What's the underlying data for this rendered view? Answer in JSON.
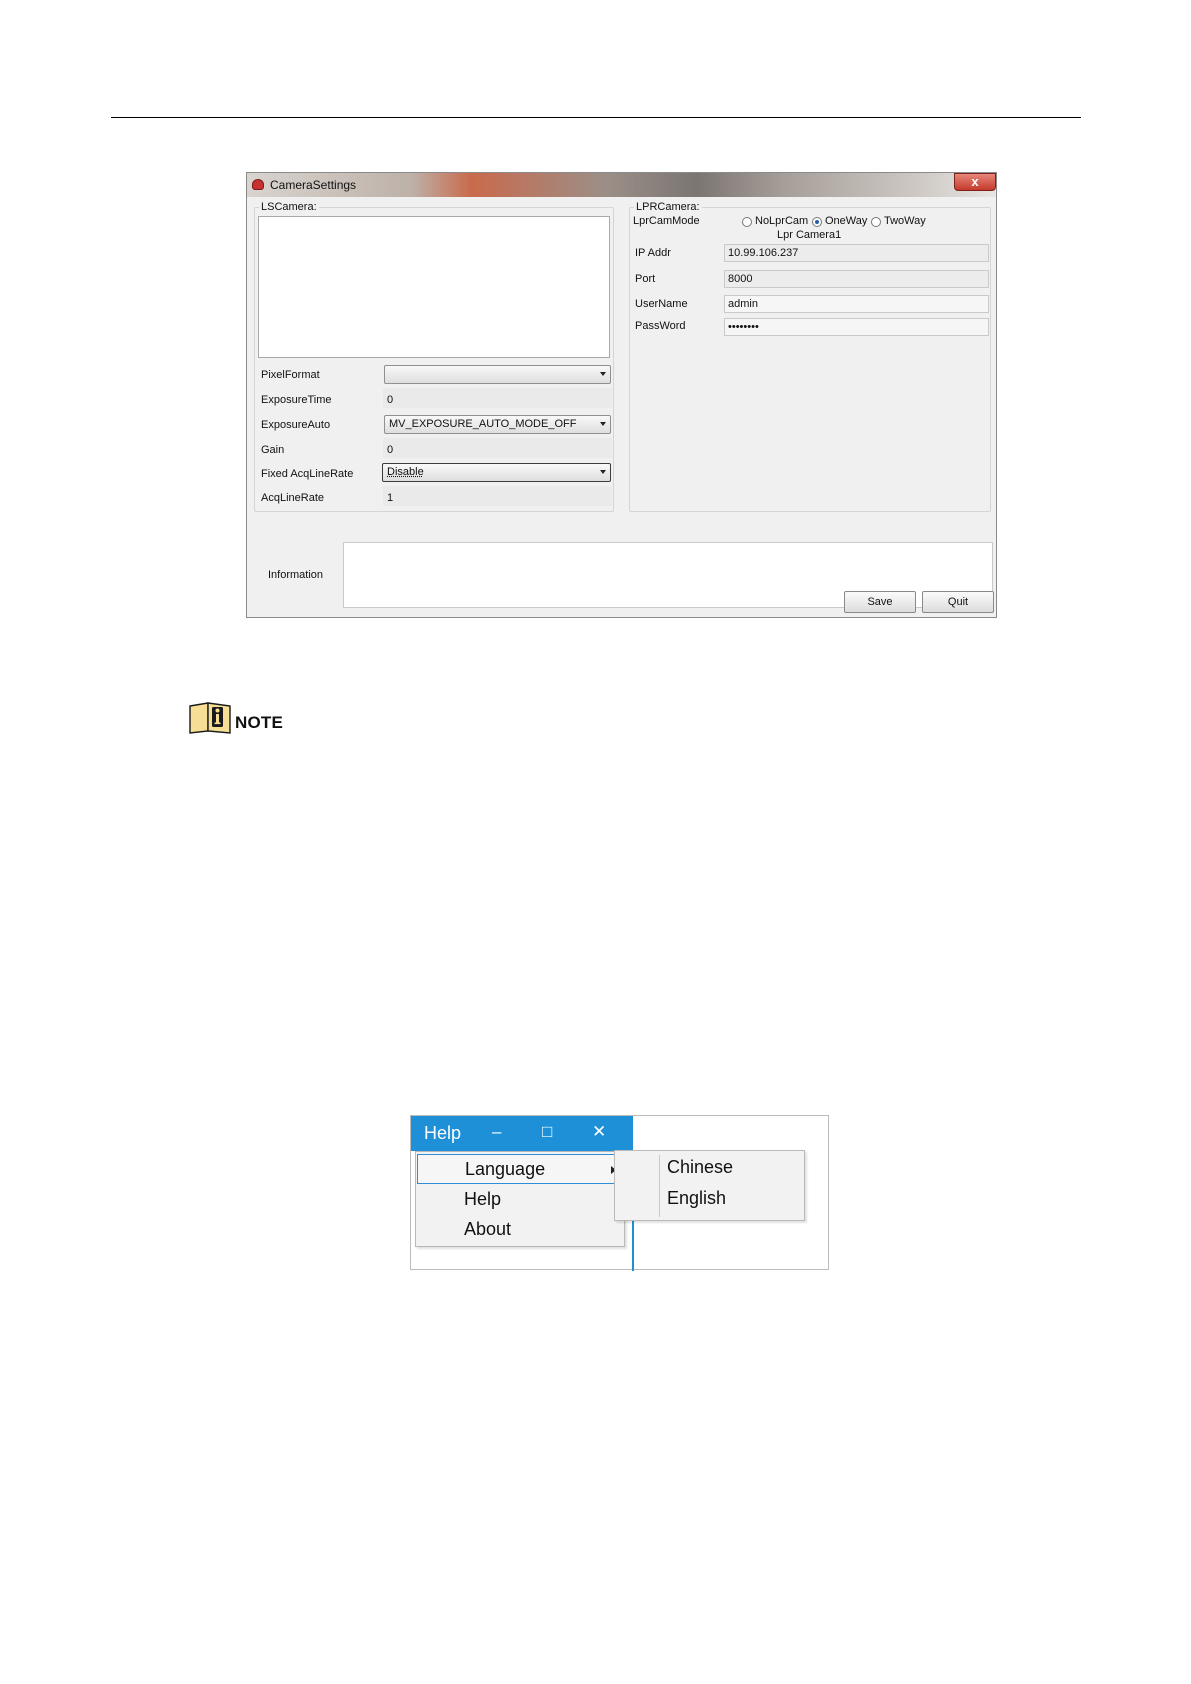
{
  "camera_settings": {
    "title": "CameraSettings",
    "close_glyph": "x",
    "ls_camera": {
      "group_label": "LSCamera:",
      "fields": {
        "pixel_format": {
          "label": "PixelFormat",
          "value": ""
        },
        "exposure_time": {
          "label": "ExposureTime",
          "value": "0"
        },
        "exposure_auto": {
          "label": "ExposureAuto",
          "value": "MV_EXPOSURE_AUTO_MODE_OFF"
        },
        "gain": {
          "label": "Gain",
          "value": "0"
        },
        "fixed_acq_line_rate": {
          "label": "Fixed AcqLineRate",
          "value": "Disable"
        },
        "acq_line_rate": {
          "label": "AcqLineRate",
          "value": "1"
        }
      }
    },
    "lpr_camera": {
      "group_label": "LPRCamera:",
      "mode_label": "LprCamMode",
      "modes": [
        "NoLprCam",
        "OneWay",
        "TwoWay"
      ],
      "selected_mode": "OneWay",
      "camera_name": "Lpr Camera1",
      "ip": {
        "label": "IP Addr",
        "value": "10.99.106.237"
      },
      "port": {
        "label": "Port",
        "value": "8000"
      },
      "username": {
        "label": "UserName",
        "value": "admin"
      },
      "password": {
        "label": "PassWord",
        "value": "••••••••"
      }
    },
    "information_label": "Information",
    "save_label": "Save",
    "quit_label": "Quit"
  },
  "note": {
    "label": "NOTE",
    "icon": "info-book-icon"
  },
  "help_menu": {
    "title": "Help",
    "controls": {
      "minimize": "–",
      "maximize": "□",
      "close": "✕"
    },
    "items": [
      "Language",
      "Help",
      "About"
    ],
    "submenu": [
      "Chinese",
      "English"
    ],
    "accent_color": "#1e90d8"
  }
}
